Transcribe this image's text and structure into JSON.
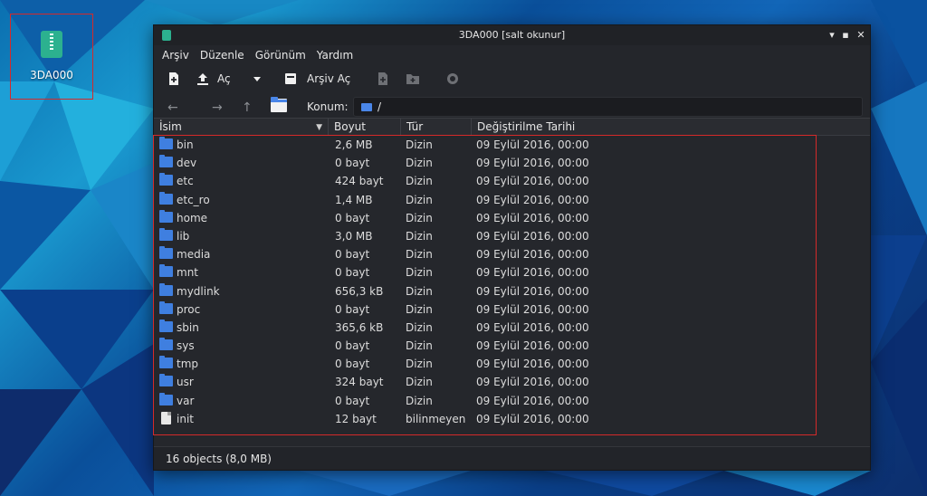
{
  "desktop": {
    "icon_label": "3DA000"
  },
  "window": {
    "title": "3DA000 [salt okunur]",
    "controls": {
      "minimize": "▾",
      "maximize": "▪",
      "close": "✕"
    }
  },
  "menu": [
    "Arşiv",
    "Düzenle",
    "Görünüm",
    "Yardım"
  ],
  "toolbar": {
    "open_label": "Aç",
    "open_archive_label": "Arşiv Aç"
  },
  "location": {
    "label": "Konum:",
    "path": "/"
  },
  "columns": {
    "name": "İsim",
    "size": "Boyut",
    "type": "Tür",
    "modified": "Değiştirilme Tarihi"
  },
  "files": [
    {
      "name": "bin",
      "size": "2,6 MB",
      "type": "Dizin",
      "modified": "09 Eylül 2016, 00:00",
      "icon": "folder-icon"
    },
    {
      "name": "dev",
      "size": "0 bayt",
      "type": "Dizin",
      "modified": "09 Eylül 2016, 00:00",
      "icon": "folder-icon"
    },
    {
      "name": "etc",
      "size": "424 bayt",
      "type": "Dizin",
      "modified": "09 Eylül 2016, 00:00",
      "icon": "folder-icon"
    },
    {
      "name": "etc_ro",
      "size": "1,4 MB",
      "type": "Dizin",
      "modified": "09 Eylül 2016, 00:00",
      "icon": "folder-icon"
    },
    {
      "name": "home",
      "size": "0 bayt",
      "type": "Dizin",
      "modified": "09 Eylül 2016, 00:00",
      "icon": "folder-icon"
    },
    {
      "name": "lib",
      "size": "3,0 MB",
      "type": "Dizin",
      "modified": "09 Eylül 2016, 00:00",
      "icon": "folder-icon"
    },
    {
      "name": "media",
      "size": "0 bayt",
      "type": "Dizin",
      "modified": "09 Eylül 2016, 00:00",
      "icon": "folder-icon"
    },
    {
      "name": "mnt",
      "size": "0 bayt",
      "type": "Dizin",
      "modified": "09 Eylül 2016, 00:00",
      "icon": "folder-icon"
    },
    {
      "name": "mydlink",
      "size": "656,3 kB",
      "type": "Dizin",
      "modified": "09 Eylül 2016, 00:00",
      "icon": "folder-icon"
    },
    {
      "name": "proc",
      "size": "0 bayt",
      "type": "Dizin",
      "modified": "09 Eylül 2016, 00:00",
      "icon": "folder-icon"
    },
    {
      "name": "sbin",
      "size": "365,6 kB",
      "type": "Dizin",
      "modified": "09 Eylül 2016, 00:00",
      "icon": "folder-icon"
    },
    {
      "name": "sys",
      "size": "0 bayt",
      "type": "Dizin",
      "modified": "09 Eylül 2016, 00:00",
      "icon": "folder-icon"
    },
    {
      "name": "tmp",
      "size": "0 bayt",
      "type": "Dizin",
      "modified": "09 Eylül 2016, 00:00",
      "icon": "folder-icon"
    },
    {
      "name": "usr",
      "size": "324 bayt",
      "type": "Dizin",
      "modified": "09 Eylül 2016, 00:00",
      "icon": "folder-icon"
    },
    {
      "name": "var",
      "size": "0 bayt",
      "type": "Dizin",
      "modified": "09 Eylül 2016, 00:00",
      "icon": "folder-icon"
    },
    {
      "name": "init",
      "size": "12 bayt",
      "type": "bilinmeyen",
      "modified": "09 Eylül 2016, 00:00",
      "icon": "file-icon"
    }
  ],
  "status": "16 objects (8,0 MB)",
  "colors": {
    "window_bg": "#24262b",
    "folder": "#3f7fe0",
    "highlight": "#d42a2a",
    "archive_green": "#2cb18f"
  }
}
